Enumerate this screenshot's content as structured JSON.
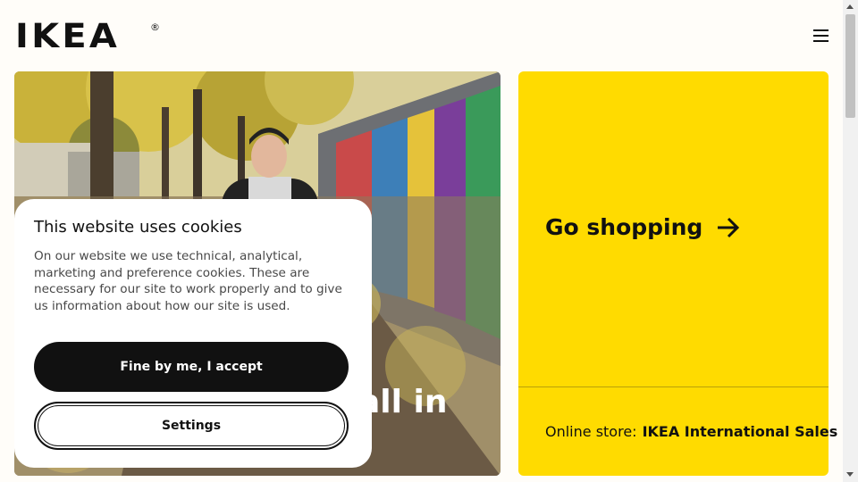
{
  "header": {
    "logo_text": "IKEA",
    "logo_mark": "®",
    "menu_icon": "hamburger-menu-icon"
  },
  "hero": {
    "title_partial": "all in"
  },
  "promo": {
    "go_shopping_label": "Go shopping",
    "arrow_icon": "arrow-right-icon",
    "online_store_prefix": "Online store:",
    "online_store_name": "IKEA International Sales",
    "chevron_icon": "chevron-up-icon",
    "background_color": "#ffdb00"
  },
  "cookie_banner": {
    "title": "This website uses cookies",
    "body": "On our website we use technical, analytical, marketing and preference cookies. These are necessary for our site to work properly and to give us information about how our site is used.",
    "accept_label": "Fine by me, I accept",
    "settings_label": "Settings"
  },
  "colors": {
    "background": "#fffdf9",
    "text": "#111111",
    "accent_yellow": "#ffdb00"
  }
}
